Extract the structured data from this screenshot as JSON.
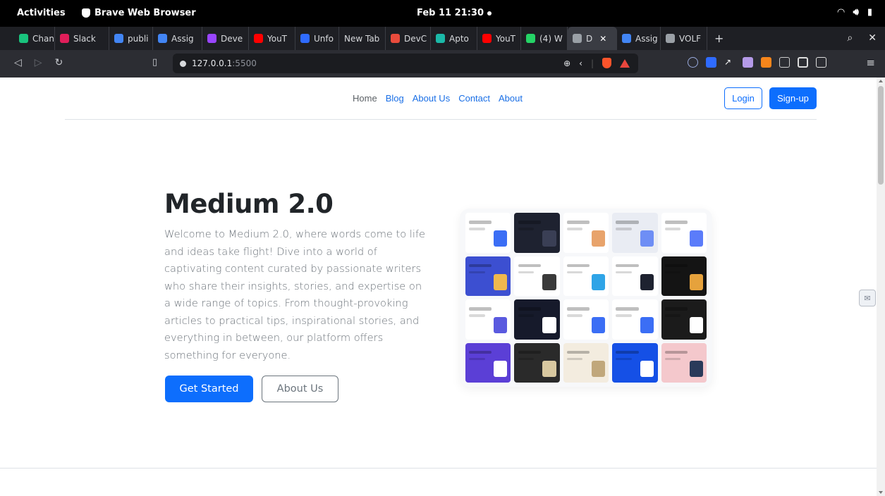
{
  "system_bar": {
    "activities": "Activities",
    "app_name": "Brave Web Browser",
    "clock": "Feb 11  21:30"
  },
  "tabs": [
    {
      "label": "Chan",
      "color": "#19c37d"
    },
    {
      "label": "Slack",
      "color": "#e01e5a"
    },
    {
      "label": "publi",
      "color": "#4285f4"
    },
    {
      "label": "Assig",
      "color": "#4285f4"
    },
    {
      "label": "Deve",
      "color": "#9945ff"
    },
    {
      "label": "YouT",
      "color": "#ff0000"
    },
    {
      "label": "Unfo",
      "color": "#2f6bff"
    },
    {
      "label": "New Tab",
      "color": ""
    },
    {
      "label": "DevC",
      "color": "#e94b3c"
    },
    {
      "label": "Apto",
      "color": "#1bb9a8"
    },
    {
      "label": "YouT",
      "color": "#ff0000"
    },
    {
      "label": "(4) W",
      "color": "#25d366"
    },
    {
      "label": "D",
      "color": "#9aa0a6",
      "active": true
    },
    {
      "label": "Assig",
      "color": "#4285f4"
    },
    {
      "label": "VOLF",
      "color": "#9aa0a6"
    }
  ],
  "url": {
    "host": "127.0.0.1",
    "port": ":5500"
  },
  "site": {
    "nav": {
      "home": "Home",
      "blog": "Blog",
      "about_us": "About Us",
      "contact": "Contact",
      "about": "About"
    },
    "login": "Login",
    "signup": "Sign-up",
    "hero": {
      "title": "Medium 2.0",
      "text": "Welcome to Medium 2.0, where words come to life and ideas take flight! Dive into a world of captivating content curated by passionate writers who share their insights, stories, and expertise on a wide range of topics. From thought-provoking articles to practical tips, inspirational stories, and everything in between, our platform offers something for everyone.",
      "primary_cta": "Get Started",
      "secondary_cta": "About Us"
    }
  },
  "colors": {
    "primary": "#0d6efd",
    "text_muted": "#6c737a",
    "heading": "#212529"
  }
}
